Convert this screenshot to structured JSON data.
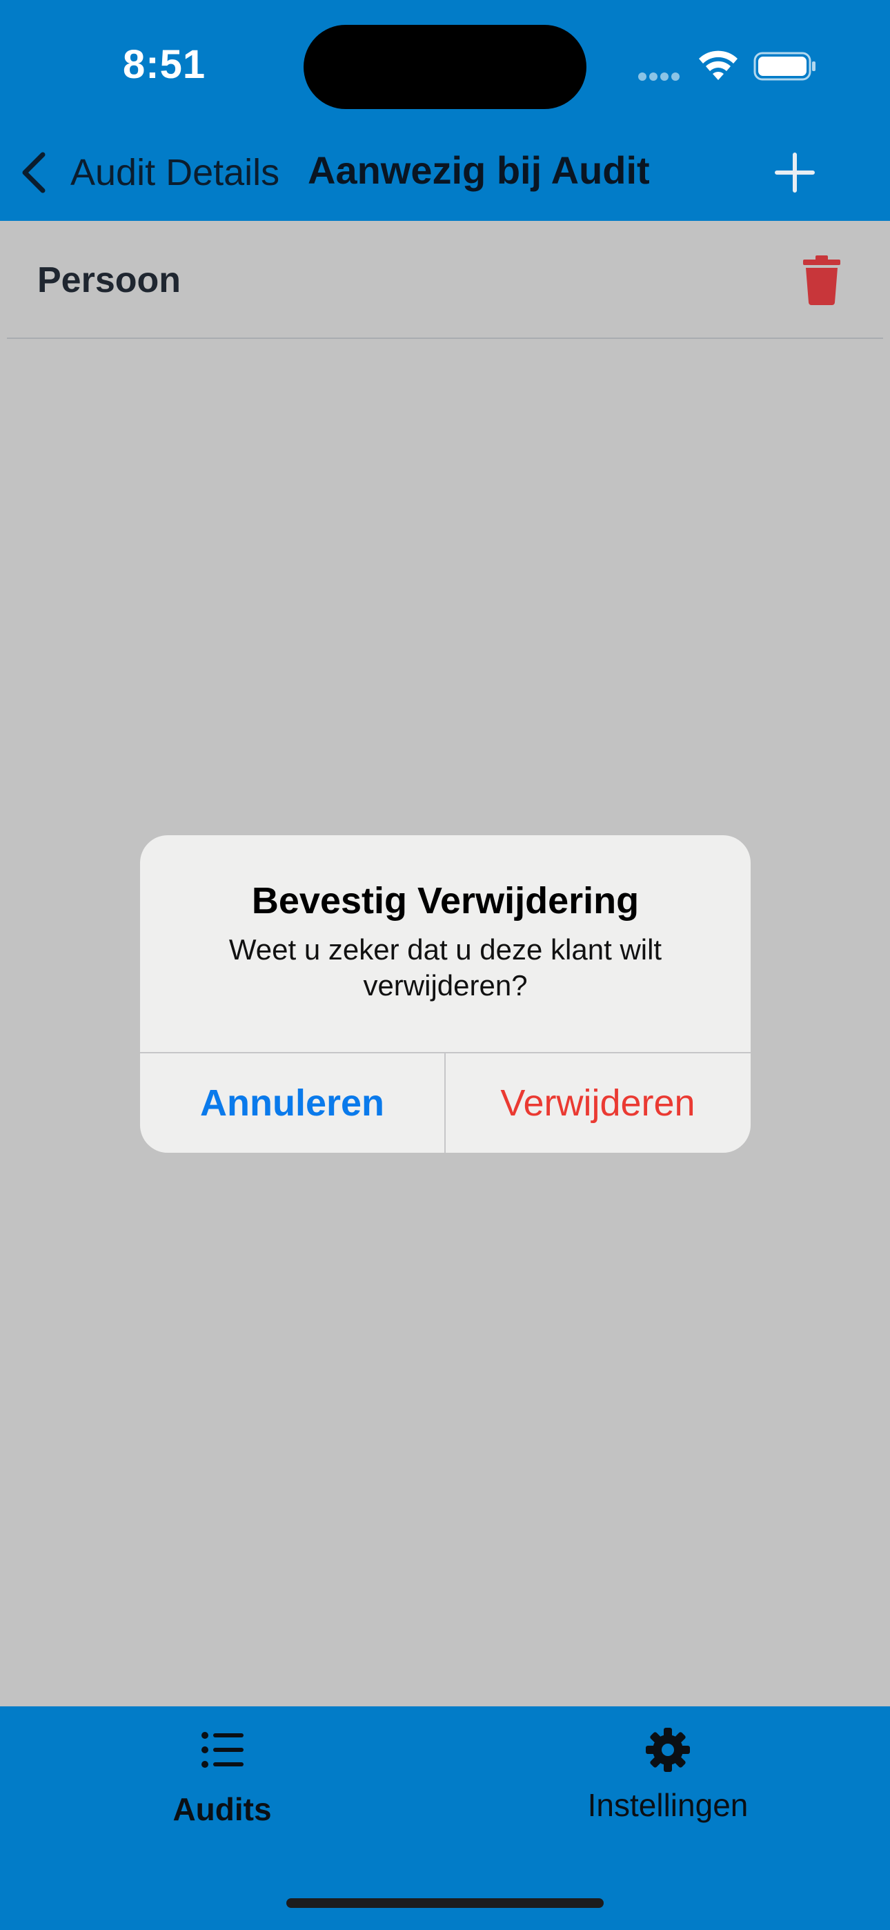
{
  "status_bar": {
    "time": "8:51",
    "icons": [
      "signal-dots-icon",
      "wifi-icon",
      "battery-icon"
    ]
  },
  "nav": {
    "back_label": "Audit Details",
    "title": "Aanwezig bij Audit",
    "back_icon": "chevron-left-icon",
    "add_icon": "plus-icon"
  },
  "list": {
    "items": [
      {
        "label": "Persoon",
        "action_icon": "trash-icon"
      }
    ]
  },
  "alert": {
    "title": "Bevestig Verwijdering",
    "message": "Weet u zeker dat u deze klant wilt verwijderen?",
    "cancel_label": "Annuleren",
    "confirm_label": "Verwijderen"
  },
  "tabbar": {
    "tabs": [
      {
        "label": "Audits",
        "icon": "list-icon",
        "selected": true
      },
      {
        "label": "Instellingen",
        "icon": "gear-icon",
        "selected": false
      }
    ]
  },
  "colors": {
    "brand_blue": "#027cc8",
    "dim_background": "#c2c2c2",
    "alert_background": "#efefee",
    "cancel_blue": "#0a7aeb",
    "destructive_red": "#ea3a32",
    "trash_red": "#c8363a"
  }
}
